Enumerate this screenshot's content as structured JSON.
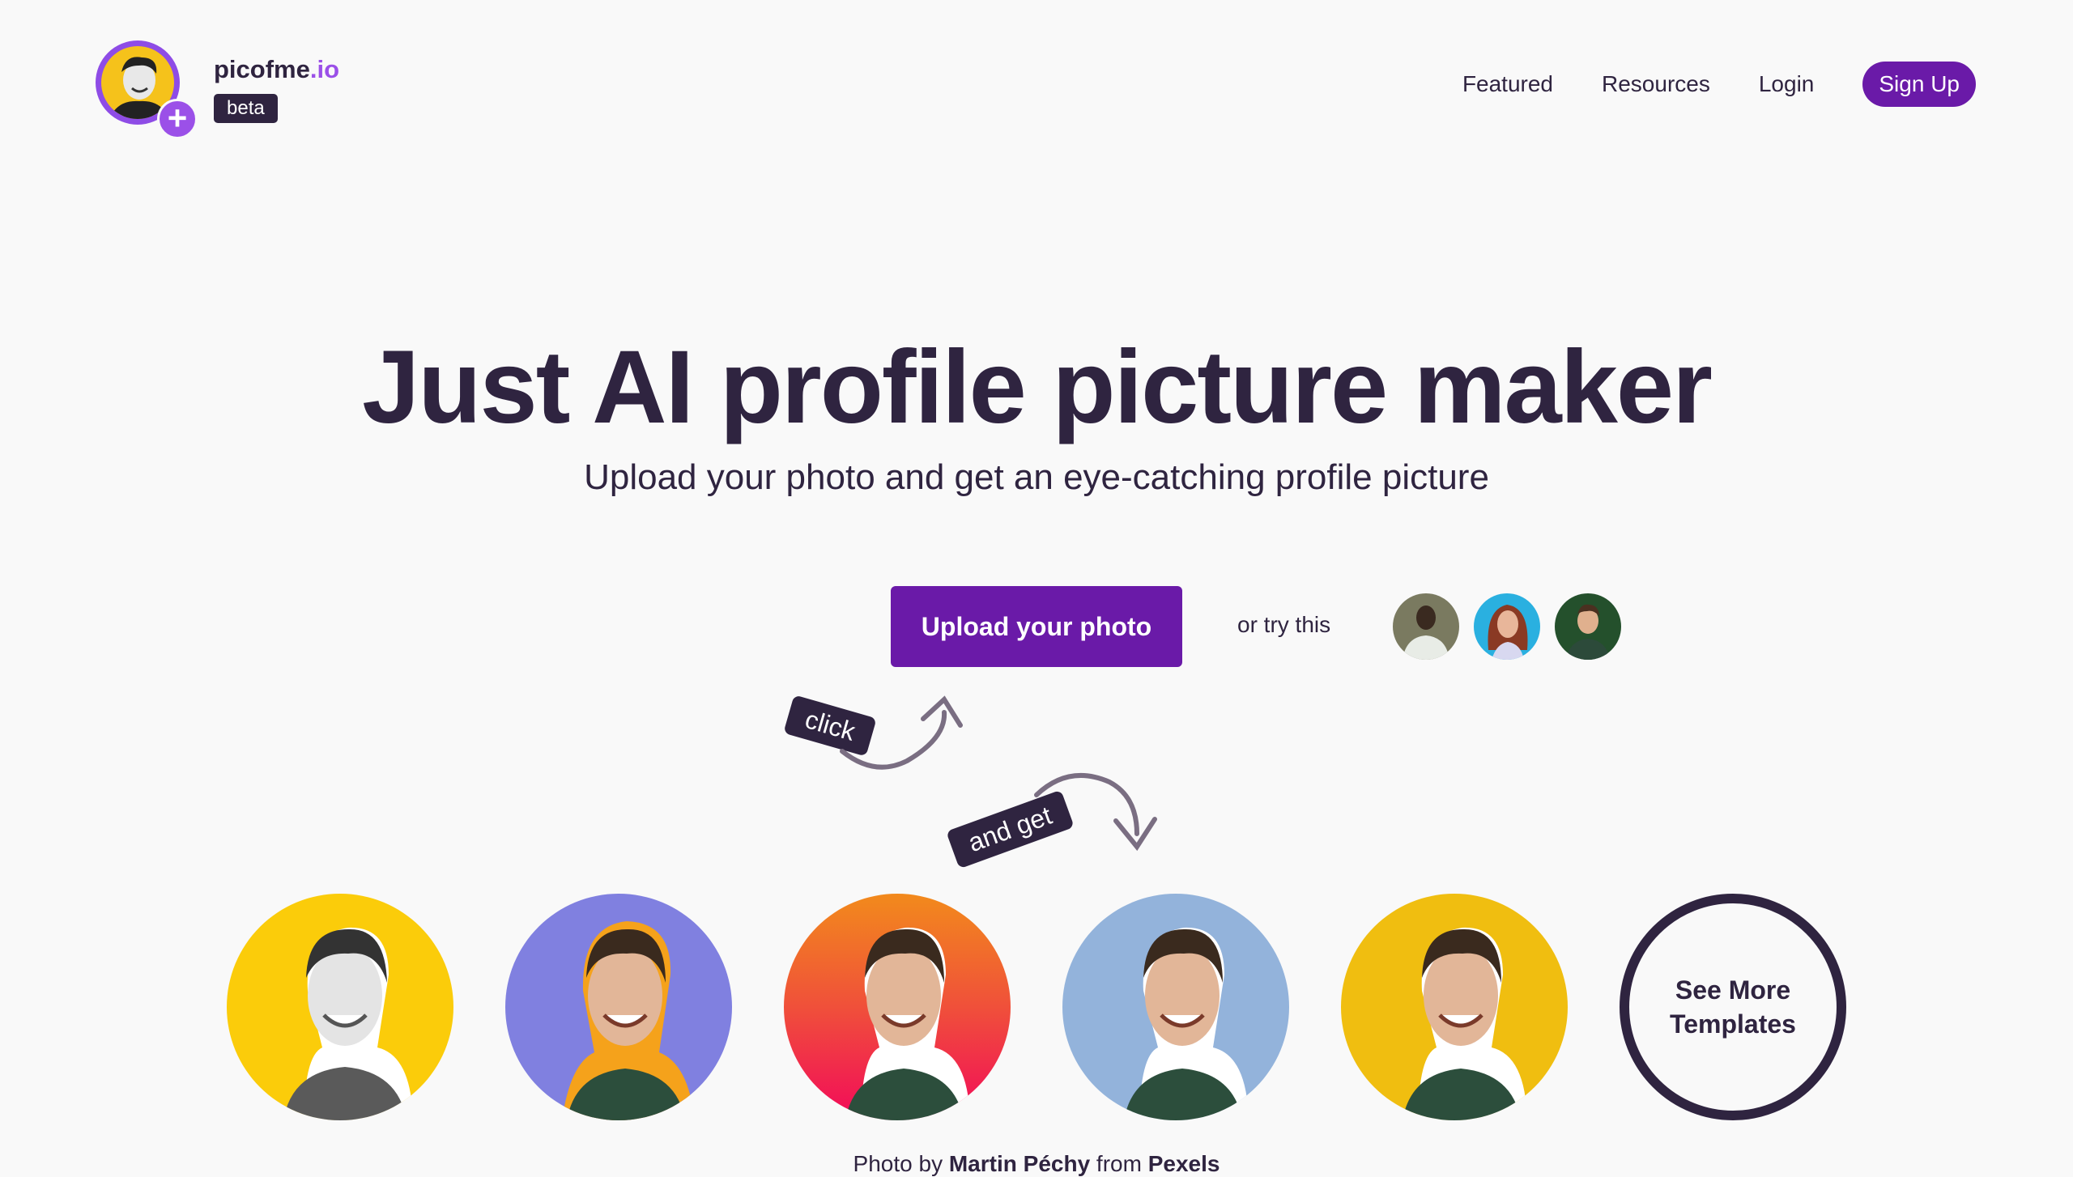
{
  "header": {
    "brand_name": "picofme",
    "brand_tld": ".io",
    "beta_label": "beta",
    "nav": [
      {
        "label": "Featured"
      },
      {
        "label": "Resources"
      },
      {
        "label": "Login"
      }
    ],
    "signup_label": "Sign Up"
  },
  "hero": {
    "title": "Just AI profile picture maker",
    "subtitle": "Upload your photo and get an eye-catching profile picture",
    "upload_label": "Upload your photo",
    "or_try_label": "or try this",
    "samples": [
      {
        "name": "sample-photo-man-white-shirt"
      },
      {
        "name": "sample-photo-woman-red-hair"
      },
      {
        "name": "sample-photo-man-green-background"
      }
    ],
    "click_tag": "click",
    "and_get_tag": "and get"
  },
  "templates": {
    "items": [
      {
        "style": "black-white-yellow",
        "bg": "#fbcc0a"
      },
      {
        "style": "color-purple",
        "bg": "#8080e0"
      },
      {
        "style": "gradient-orange-pink",
        "bg": "linear-gradient(180deg,#f28a1c,#f0503a 45%,#f20a5a)"
      },
      {
        "style": "color-light-blue",
        "bg": "#93b3db"
      },
      {
        "style": "color-yellow",
        "bg": "#f0be10"
      }
    ],
    "see_more_line1": "See More",
    "see_more_line2": "Templates"
  },
  "credit": {
    "prefix": "Photo by",
    "author": "Martin Péchy",
    "middle": "from",
    "source": "Pexels"
  },
  "colors": {
    "brand_purple": "#6a1aa8",
    "accent_purple": "#9b50e8",
    "dark": "#2f2440",
    "background": "#f9f9f9"
  }
}
